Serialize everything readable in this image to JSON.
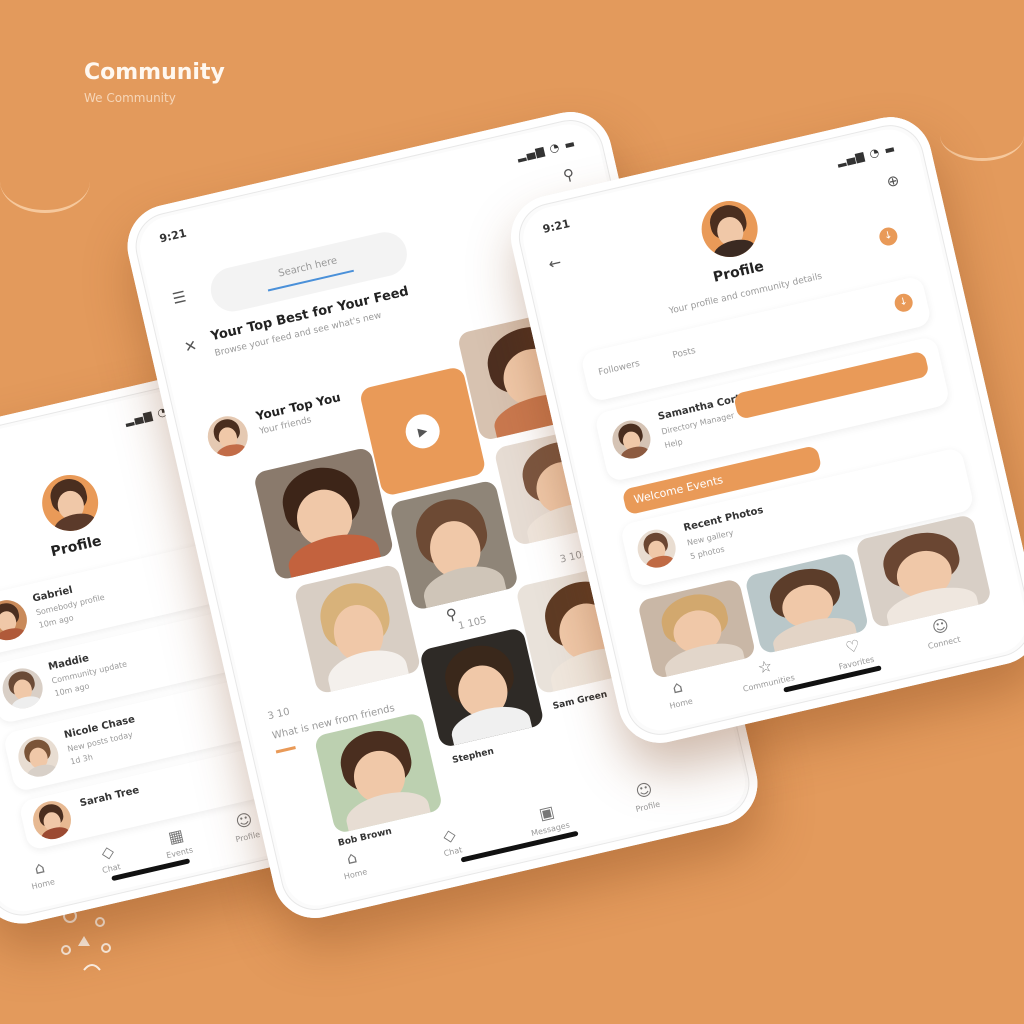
{
  "brand": {
    "title": "Community",
    "subtitle": "We Community"
  },
  "colors": {
    "background": "#e39a5c",
    "accent": "#e99a58",
    "card": "#ffffff",
    "text": "#333333"
  },
  "left_phone": {
    "time": "",
    "header": "Profile",
    "list": [
      {
        "name": "Gabriel",
        "line": "Somebody profile",
        "meta": "10m ago"
      },
      {
        "name": "Maddie",
        "line": "Community update",
        "meta": "10m ago"
      },
      {
        "name": "Nicole Chase",
        "line": "New posts today",
        "meta": "1d 3h"
      },
      {
        "name": "Sarah Tree",
        "line": "",
        "meta": ""
      }
    ],
    "nav": [
      "Home",
      "Chat",
      "Events",
      "Profile"
    ]
  },
  "center_phone": {
    "time": "9:21",
    "search_placeholder": "Search here",
    "headline": "Your Top Best for Your Feed",
    "headline_sub": "Browse your feed and see what's new",
    "feed_title": "Your Top You",
    "feed_sub": "Your friends",
    "counts": [
      "3 105",
      "1 105",
      "3 10"
    ],
    "section_title": "What is new from friends",
    "names": [
      "Bob Brown",
      "Stephen",
      "Sam Green"
    ],
    "nav": [
      "Home",
      "Chat",
      "Messages",
      "Profile"
    ]
  },
  "right_phone": {
    "time": "9:21",
    "header": "Profile",
    "bio": "Your profile and community details",
    "stats": [
      "Followers",
      "Posts"
    ],
    "person": {
      "name": "Samantha Cortez",
      "line": "Directory Manager",
      "meta": "Help"
    },
    "banner": "Welcome Events",
    "event": {
      "title": "Recent Photos",
      "line": "New gallery",
      "meta": "5 photos"
    },
    "nav": [
      "Home",
      "Communities",
      "Favorites",
      "Connect"
    ]
  }
}
